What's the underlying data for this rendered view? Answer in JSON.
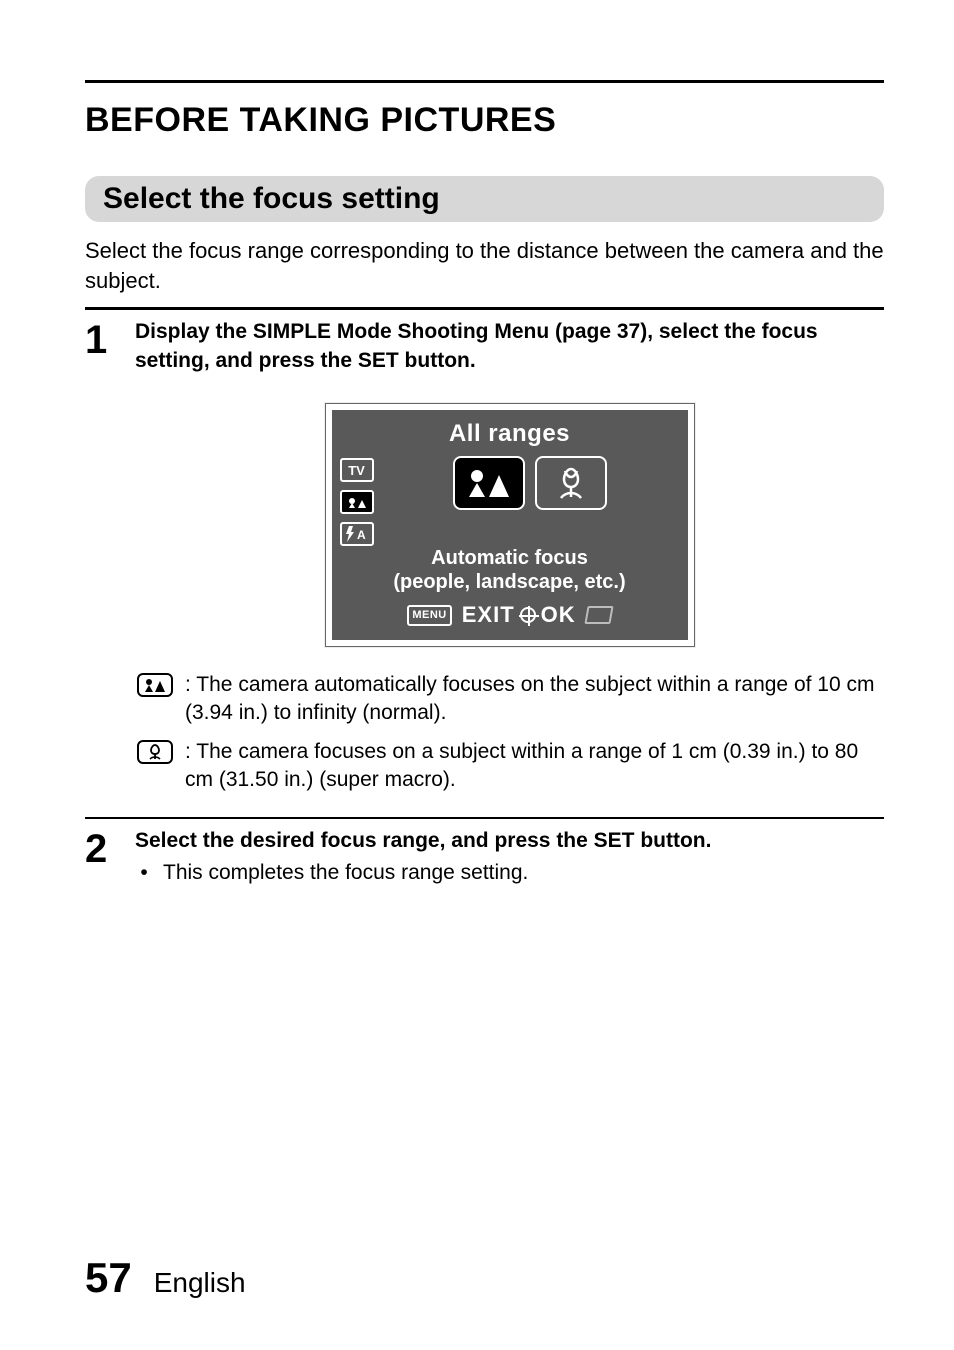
{
  "header": {
    "title": "BEFORE TAKING PICTURES"
  },
  "section": {
    "title": "Select the focus setting"
  },
  "lead": "Select the focus range corresponding to the distance between the camera and the subject.",
  "steps": {
    "one": {
      "num": "1",
      "text": "Display the SIMPLE Mode Shooting Menu (page 37), select the focus setting, and press the SET button."
    },
    "two": {
      "num": "2",
      "text": "Select the desired focus range, and press the SET button.",
      "bullet": "This completes the focus range setting."
    }
  },
  "screen": {
    "header": "All ranges",
    "side": {
      "tv": "TV",
      "focus_icon": "focus-mode-icon",
      "flash": "A"
    },
    "caption_line1": "Automatic focus",
    "caption_line2": "(people, landscape, etc.)",
    "footer": {
      "menu_chip": "MENU",
      "exit": "EXIT",
      "ok": "OK"
    }
  },
  "defs": {
    "normal": "The camera automatically focuses on the subject within a range of 10 cm (3.94 in.) to infinity (normal).",
    "macro": "The camera focuses on a subject within a range of 1 cm (0.39 in.) to 80 cm (31.50 in.) (super macro)."
  },
  "footer": {
    "page": "57",
    "lang": "English"
  }
}
